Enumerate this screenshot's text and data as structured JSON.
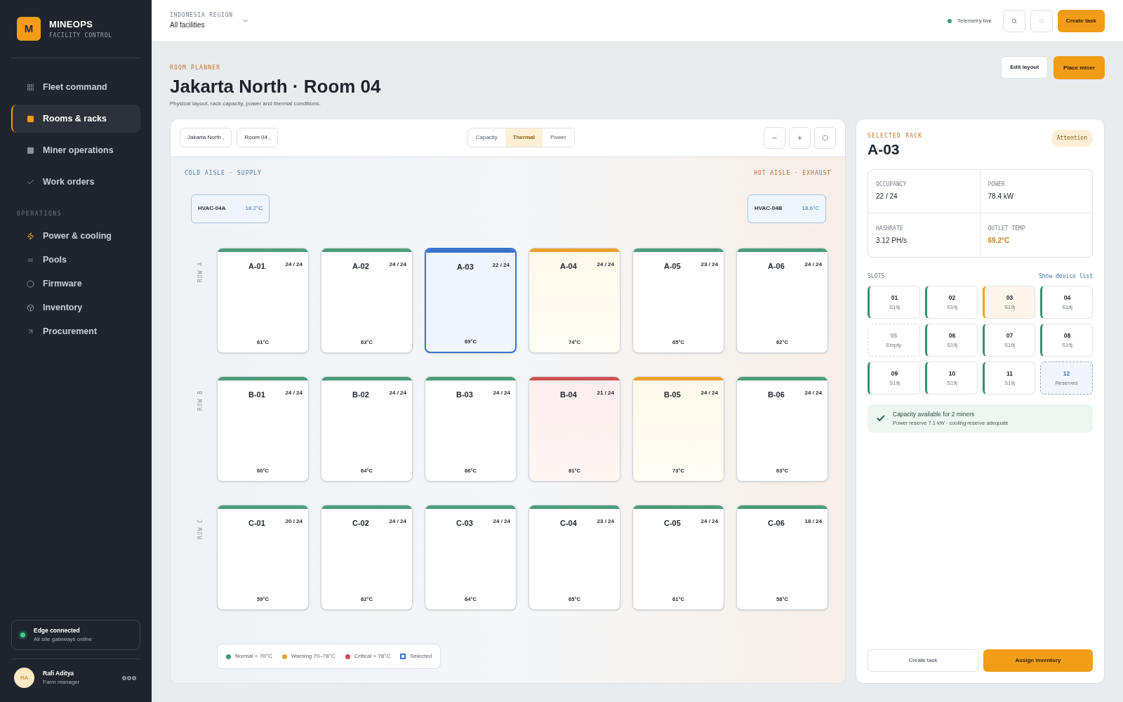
{
  "brand": {
    "logo": "M",
    "name": "MINEOPS",
    "tagline": "FACILITY CONTROL"
  },
  "nav": [
    {
      "label": "Fleet command",
      "selected": false
    },
    {
      "label": "Rooms & racks",
      "selected": true
    },
    {
      "label": "Miner operations",
      "selected": false
    },
    {
      "label": "Work orders",
      "selected": false
    }
  ],
  "nav_section": "OPERATIONS",
  "nav_ops": [
    {
      "label": "Power & cooling",
      "selected": false
    },
    {
      "label": "Pools",
      "selected": false
    },
    {
      "label": "Firmware",
      "selected": false
    },
    {
      "label": "Inventory",
      "selected": false
    },
    {
      "label": "Procurement",
      "selected": false
    }
  ],
  "edge": {
    "title": "Edge connected",
    "subtitle": "All site gateways online"
  },
  "user": {
    "initials": "RA",
    "name": "Rafi Aditya",
    "role": "Farm manager"
  },
  "topbar": {
    "region_label": "INDONESIA REGION",
    "region": "All facilities",
    "status": "Telemetry live",
    "action": "Create task"
  },
  "header": {
    "eyebrow": "ROOM PLANNER",
    "title": "Jakarta North · Room 04",
    "subtitle": "Physical layout, rack capacity, power and thermal conditions.",
    "buttons": [
      {
        "label": "Edit layout",
        "kind": "secondary"
      },
      {
        "label": "Place miner",
        "kind": "primary"
      }
    ]
  },
  "planner": {
    "filters": [
      "Jakarta North ,",
      "Room 04 ,"
    ],
    "modes": [
      {
        "label": "Capacity",
        "selected": false
      },
      {
        "label": "Thermal",
        "selected": true
      },
      {
        "label": "Power",
        "selected": false
      }
    ],
    "cold_aisle": "COLD AISLE · SUPPLY",
    "hot_aisle": "HOT AISLE · EXHAUST",
    "hvac": [
      {
        "name": "HVAC-04A",
        "temp": "18.2°C"
      },
      {
        "name": "HVAC-04B",
        "temp": "18.6°C"
      }
    ],
    "rows": [
      {
        "label": "ROW A",
        "racks": [
          {
            "id": "A-01",
            "occupancy": "24 / 24",
            "temp": "61°C",
            "kind": "normal",
            "selected": false
          },
          {
            "id": "A-02",
            "occupancy": "24 / 24",
            "temp": "63°C",
            "kind": "normal",
            "selected": false
          },
          {
            "id": "A-03",
            "occupancy": "22 / 24",
            "temp": "69°C",
            "kind": "normal",
            "selected": true
          },
          {
            "id": "A-04",
            "occupancy": "24 / 24",
            "temp": "74°C",
            "kind": "warning",
            "selected": false
          },
          {
            "id": "A-05",
            "occupancy": "23 / 24",
            "temp": "65°C",
            "kind": "normal",
            "selected": false
          },
          {
            "id": "A-06",
            "occupancy": "24 / 24",
            "temp": "62°C",
            "kind": "normal",
            "selected": false
          }
        ]
      },
      {
        "label": "ROW B",
        "racks": [
          {
            "id": "B-01",
            "occupancy": "24 / 24",
            "temp": "60°C",
            "kind": "normal",
            "selected": false
          },
          {
            "id": "B-02",
            "occupancy": "24 / 24",
            "temp": "64°C",
            "kind": "normal",
            "selected": false
          },
          {
            "id": "B-03",
            "occupancy": "24 / 24",
            "temp": "66°C",
            "kind": "normal",
            "selected": false
          },
          {
            "id": "B-04",
            "occupancy": "21 / 24",
            "temp": "81°C",
            "kind": "critical",
            "selected": false
          },
          {
            "id": "B-05",
            "occupancy": "24 / 24",
            "temp": "73°C",
            "kind": "warning",
            "selected": false
          },
          {
            "id": "B-06",
            "occupancy": "24 / 24",
            "temp": "63°C",
            "kind": "normal",
            "selected": false
          }
        ]
      },
      {
        "label": "ROW C",
        "racks": [
          {
            "id": "C-01",
            "occupancy": "20 / 24",
            "temp": "59°C",
            "kind": "normal",
            "selected": false
          },
          {
            "id": "C-02",
            "occupancy": "24 / 24",
            "temp": "62°C",
            "kind": "normal",
            "selected": false
          },
          {
            "id": "C-03",
            "occupancy": "24 / 24",
            "temp": "64°C",
            "kind": "normal",
            "selected": false
          },
          {
            "id": "C-04",
            "occupancy": "23 / 24",
            "temp": "65°C",
            "kind": "normal",
            "selected": false
          },
          {
            "id": "C-05",
            "occupancy": "24 / 24",
            "temp": "61°C",
            "kind": "normal",
            "selected": false
          },
          {
            "id": "C-06",
            "occupancy": "18 / 24",
            "temp": "58°C",
            "kind": "normal",
            "selected": false
          }
        ]
      }
    ],
    "legend": [
      {
        "label": "Normal < 70°C",
        "kind": "dot",
        "color": "#3f9a74"
      },
      {
        "label": "Warning 70–78°C",
        "kind": "dot",
        "color": "#eea12a"
      },
      {
        "label": "Critical > 78°C",
        "kind": "dot",
        "color": "#cf4b4b"
      },
      {
        "label": "Selected",
        "kind": "square",
        "color": "#3b73c9"
      }
    ]
  },
  "rack_panel": {
    "eyebrow": "SELECTED RACK",
    "title": "A-03",
    "badge": "Attention",
    "stats": [
      {
        "label": "OCCUPANCY",
        "value": "22 / 24",
        "kind": "plain"
      },
      {
        "label": "POWER",
        "value": "78.4 kW",
        "kind": "plain"
      },
      {
        "label": "HASHRATE",
        "value": "3.12 PH/s",
        "kind": "plain"
      },
      {
        "label": "OUTLET TEMP",
        "value": "69.2°C",
        "kind": "warning"
      }
    ],
    "slots_label": "SLOTS",
    "slots_link": "Show device list",
    "slots": [
      {
        "number": "01",
        "model": "S19j",
        "kind": "ok"
      },
      {
        "number": "02",
        "model": "S19j",
        "kind": "ok"
      },
      {
        "number": "03",
        "model": "S19j",
        "kind": "warning"
      },
      {
        "number": "04",
        "model": "S19j",
        "kind": "ok"
      },
      {
        "number": "05",
        "model": "Empty",
        "kind": "empty"
      },
      {
        "number": "06",
        "model": "S19j",
        "kind": "ok"
      },
      {
        "number": "07",
        "model": "S19j",
        "kind": "ok"
      },
      {
        "number": "08",
        "model": "S19j",
        "kind": "ok"
      },
      {
        "number": "09",
        "model": "S19j",
        "kind": "ok"
      },
      {
        "number": "10",
        "model": "S19j",
        "kind": "ok"
      },
      {
        "number": "11",
        "model": "S19j",
        "kind": "ok"
      },
      {
        "number": "12",
        "model": "Reserved",
        "kind": "reserved"
      }
    ],
    "notice": {
      "title": "Capacity available for 2 miners",
      "subtitle": "Power reserve 7.1 kW · cooling reserve adequate"
    },
    "buttons": [
      {
        "label": "Create task",
        "kind": "secondary"
      },
      {
        "label": "Assign inventory",
        "kind": "primary"
      }
    ]
  }
}
